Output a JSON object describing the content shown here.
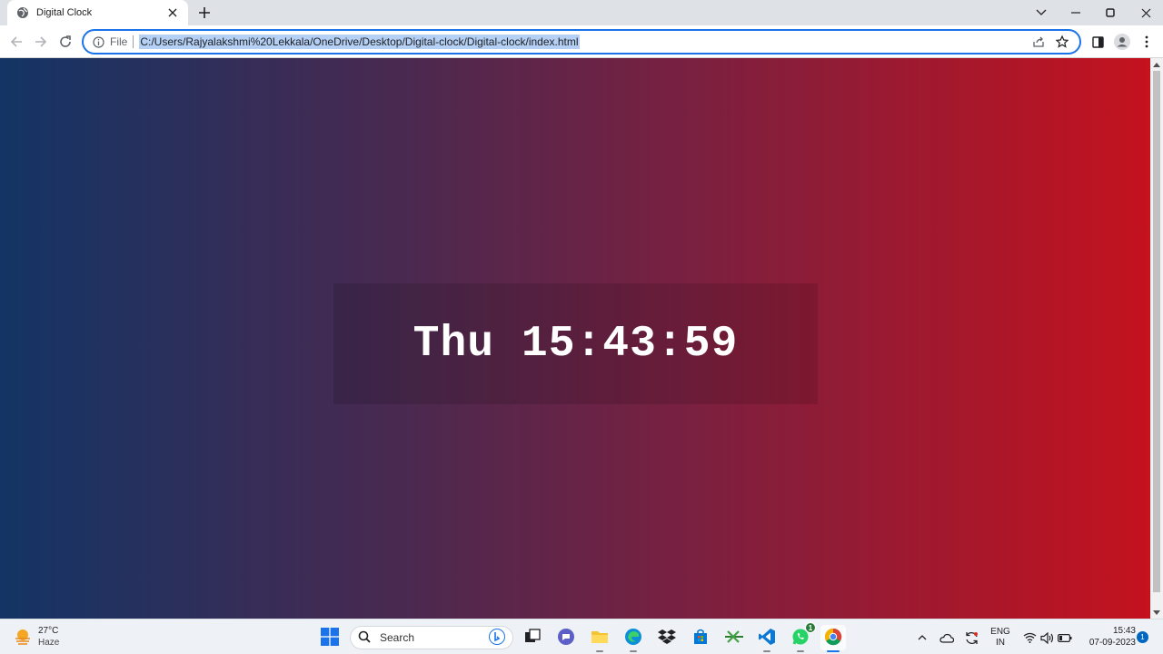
{
  "browser": {
    "tab": {
      "title": "Digital Clock",
      "favicon": "globe-icon"
    },
    "address_bar": {
      "scheme_label": "File",
      "url": "C:/Users/Rajyalakshmi%20Lekkala/OneDrive/Desktop/Digital-clock/Digital-clock/index.html"
    },
    "accent_color": "#1a73e8"
  },
  "page": {
    "clock_text": "Thu 15:43:59",
    "gradient_colors": [
      "#133465",
      "#c4121e"
    ]
  },
  "taskbar": {
    "weather": {
      "temperature": "27°C",
      "condition": "Haze"
    },
    "search_label": "Search",
    "whatsapp_badge": "1",
    "language": {
      "line1": "ENG",
      "line2": "IN"
    },
    "clock": {
      "time": "15:43",
      "date": "07-09-2023"
    },
    "notification_count": "1"
  }
}
